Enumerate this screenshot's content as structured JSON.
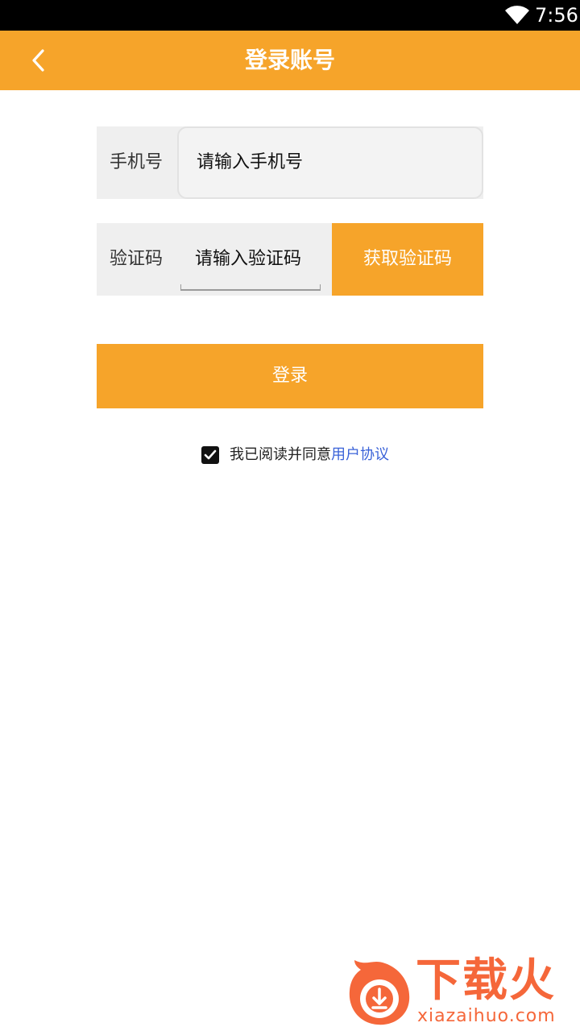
{
  "status_bar": {
    "time": "7:56"
  },
  "header": {
    "title": "登录账号"
  },
  "form": {
    "phone": {
      "label": "手机号",
      "placeholder": "请输入手机号"
    },
    "code": {
      "label": "验证码",
      "placeholder": "请输入验证码",
      "get_code_label": "获取验证码"
    },
    "login_label": "登录"
  },
  "agreement": {
    "checked": true,
    "text": "我已阅读并同意",
    "link_text": "用户协议"
  },
  "watermark": {
    "brand": "下载火",
    "url": "xiazaihuo.com"
  },
  "colors": {
    "accent": "#f6a42a",
    "link": "#3a62d8",
    "watermark": "#f5673a"
  },
  "icons": [
    "wifi-icon",
    "back-arrow-icon",
    "checkmark-icon",
    "download-logo-icon"
  ]
}
